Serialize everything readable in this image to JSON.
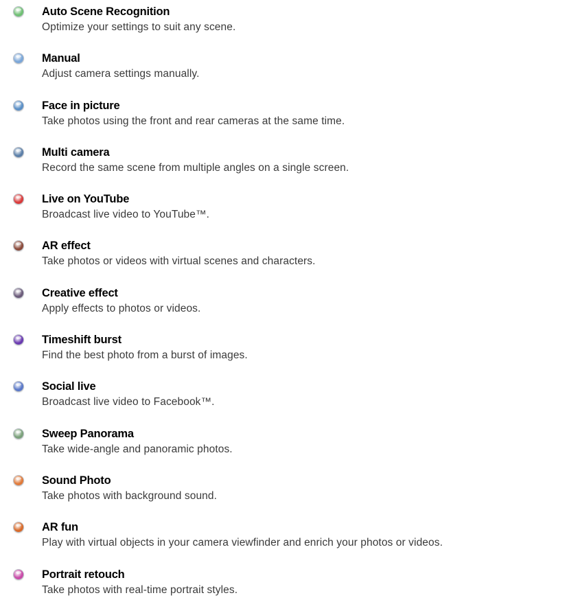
{
  "modes": [
    {
      "title": "Auto Scene Recognition",
      "description": "Optimize your settings to suit any scene.",
      "icon": "auto-scene-recognition-icon",
      "color": "#6fbf73"
    },
    {
      "title": "Manual",
      "description": "Adjust camera settings manually.",
      "icon": "manual-icon",
      "color": "#7aa6d8"
    },
    {
      "title": "Face in picture",
      "description": "Take photos using the front and rear cameras at the same time.",
      "icon": "face-in-picture-icon",
      "color": "#5a8fc6"
    },
    {
      "title": "Multi camera",
      "description": "Record the same scene from multiple angles on a single screen.",
      "icon": "multi-camera-icon",
      "color": "#5b7fa8"
    },
    {
      "title": "Live on YouTube",
      "description": "Broadcast live video to YouTube™.",
      "icon": "live-on-youtube-icon",
      "color": "#d93a3a"
    },
    {
      "title": "AR effect",
      "description": "Take photos or videos with virtual scenes and characters.",
      "icon": "ar-effect-icon",
      "color": "#8a4a3a"
    },
    {
      "title": "Creative effect",
      "description": "Apply effects to photos or videos.",
      "icon": "creative-effect-icon",
      "color": "#6b5b7a"
    },
    {
      "title": "Timeshift burst",
      "description": "Find the best photo from a burst of images.",
      "icon": "timeshift-burst-icon",
      "color": "#6a3ab0"
    },
    {
      "title": "Social live",
      "description": "Broadcast live video to Facebook™.",
      "icon": "social-live-icon",
      "color": "#5a78c8"
    },
    {
      "title": "Sweep Panorama",
      "description": "Take wide-angle and panoramic photos.",
      "icon": "sweep-panorama-icon",
      "color": "#7aa07a"
    },
    {
      "title": "Sound Photo",
      "description": "Take photos with background sound.",
      "icon": "sound-photo-icon",
      "color": "#e07a3a"
    },
    {
      "title": "AR fun",
      "description": "Play with virtual objects in your camera viewfinder and enrich your photos or videos.",
      "icon": "ar-fun-icon",
      "color": "#d86a2a"
    },
    {
      "title": "Portrait retouch",
      "description": "Take photos with real-time portrait styles.",
      "icon": "portrait-retouch-icon",
      "color": "#c84aa8"
    }
  ]
}
